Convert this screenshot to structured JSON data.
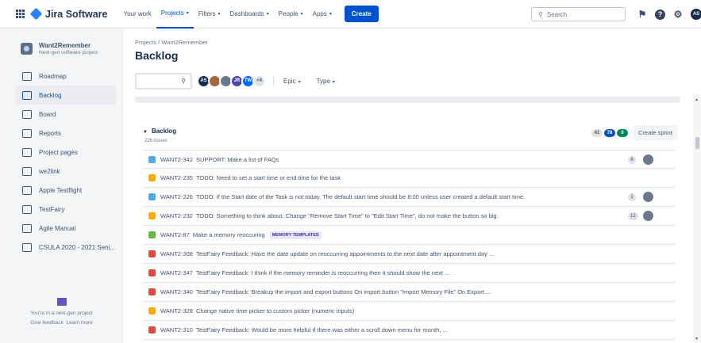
{
  "topbar": {
    "product": "Jira Software",
    "nav": [
      {
        "label": "Your work",
        "caret": false,
        "active": false
      },
      {
        "label": "Projects",
        "caret": true,
        "active": true
      },
      {
        "label": "Filters",
        "caret": true,
        "active": false
      },
      {
        "label": "Dashboards",
        "caret": true,
        "active": false
      },
      {
        "label": "People",
        "caret": true,
        "active": false
      },
      {
        "label": "Apps",
        "caret": true,
        "active": false
      }
    ],
    "create_label": "Create",
    "search_placeholder": "Search",
    "user_initials": "AS"
  },
  "sidebar": {
    "project_name": "Want2Remember",
    "project_type": "Next-gen software project",
    "items": [
      {
        "label": "Roadmap",
        "icon": "roadmap-icon",
        "active": false
      },
      {
        "label": "Backlog",
        "icon": "backlog-icon",
        "active": true
      },
      {
        "label": "Board",
        "icon": "board-icon",
        "active": false
      },
      {
        "label": "Reports",
        "icon": "reports-icon",
        "active": false
      },
      {
        "label": "Project pages",
        "icon": "pages-icon",
        "active": false
      },
      {
        "label": "we2link",
        "icon": "code-icon",
        "active": false
      },
      {
        "label": "Apple Testflight",
        "icon": "external-link-icon",
        "active": false
      },
      {
        "label": "TestFairy",
        "icon": "external-link-icon",
        "active": false
      },
      {
        "label": "Agile Manual",
        "icon": "external-link-icon",
        "active": false
      },
      {
        "label": "CSULA 2020 - 2021 Seni...",
        "icon": "external-link-icon",
        "active": false
      }
    ],
    "footer_text": "You're in a next-gen project",
    "feedback_label": "Give feedback",
    "learn_more_label": "Learn more"
  },
  "main": {
    "breadcrumb": "Projects / Want2Remember",
    "title": "Backlog",
    "avatars": [
      {
        "initials": "AS",
        "color": "#172b4d"
      },
      {
        "initials": "",
        "color": "#a5673f"
      },
      {
        "initials": "",
        "color": "#6b778c"
      },
      {
        "initials": "JR",
        "color": "#5243aa"
      },
      {
        "initials": "TW",
        "color": "#0065ff"
      },
      {
        "initials": "+4",
        "color": "#dfe1e6"
      }
    ],
    "filters": [
      "Epic",
      "Type"
    ]
  },
  "backlog": {
    "title": "Backlog",
    "count": "226 issues",
    "pills": [
      {
        "value": "41",
        "bg": "#dfe1e6",
        "fg": "#42526e"
      },
      {
        "value": "78",
        "bg": "#0052cc",
        "fg": "#ffffff"
      },
      {
        "value": "0",
        "bg": "#00875a",
        "fg": "#ffffff"
      }
    ],
    "create_sprint_label": "Create sprint"
  },
  "issues": [
    {
      "key": "WANT2-342",
      "summary": "SUPPORT: Make a list of FAQs",
      "type": "task",
      "color": "#4bade8",
      "estimate": "6",
      "avatar": true,
      "epic": ""
    },
    {
      "key": "WANT2-235",
      "summary": "TODO: Need to set a start time or end time for the task",
      "type": "todo",
      "color": "#ffab00",
      "estimate": "",
      "avatar": false,
      "epic": ""
    },
    {
      "key": "WANT2-226",
      "summary": "TODO: If the Start date of the Task is not today. The default start time should be 8:00 unless user created a default start time.",
      "type": "task",
      "color": "#4bade8",
      "estimate": "1",
      "avatar": true,
      "epic": ""
    },
    {
      "key": "WANT2-232",
      "summary": "TODO: Something to think about. Change \"Remove Start Time\" to \"Edit Start Time\", do not make the button so big.",
      "type": "todo",
      "color": "#ffab00",
      "estimate": "12",
      "avatar": true,
      "epic": ""
    },
    {
      "key": "WANT2-87",
      "summary": "Make a memory reoccuring",
      "type": "story",
      "color": "#63ba3c",
      "estimate": "",
      "avatar": false,
      "epic": "MEMORY TEMPLATES"
    },
    {
      "key": "WANT2-308",
      "summary": "TestFairy Feedback: Have the date update on reoccurring appointments to the next date after appointment day ...",
      "type": "bug",
      "color": "#e5493a",
      "estimate": "",
      "avatar": false,
      "epic": ""
    },
    {
      "key": "WANT2-347",
      "summary": "TestFairy Feedback: I think if the memory reminder is reoccurring then it should show the next ...",
      "type": "bug",
      "color": "#e5493a",
      "estimate": "",
      "avatar": false,
      "epic": ""
    },
    {
      "key": "WANT2-340",
      "summary": "TestFairy Feedback: Breakup the import and export buttons On import button \"Import Memory File\" On Export ...",
      "type": "bug",
      "color": "#e5493a",
      "estimate": "",
      "avatar": false,
      "epic": ""
    },
    {
      "key": "WANT2-328",
      "summary": "Change native time picker to custom picker (numeric inputs)",
      "type": "todo",
      "color": "#ffab00",
      "estimate": "",
      "avatar": false,
      "epic": ""
    },
    {
      "key": "WANT2-310",
      "summary": "TestFairy Feedback: Would be more helpful if there was either a scroll down menu for month, ...",
      "type": "bug",
      "color": "#e5493a",
      "estimate": "",
      "avatar": false,
      "epic": ""
    }
  ]
}
